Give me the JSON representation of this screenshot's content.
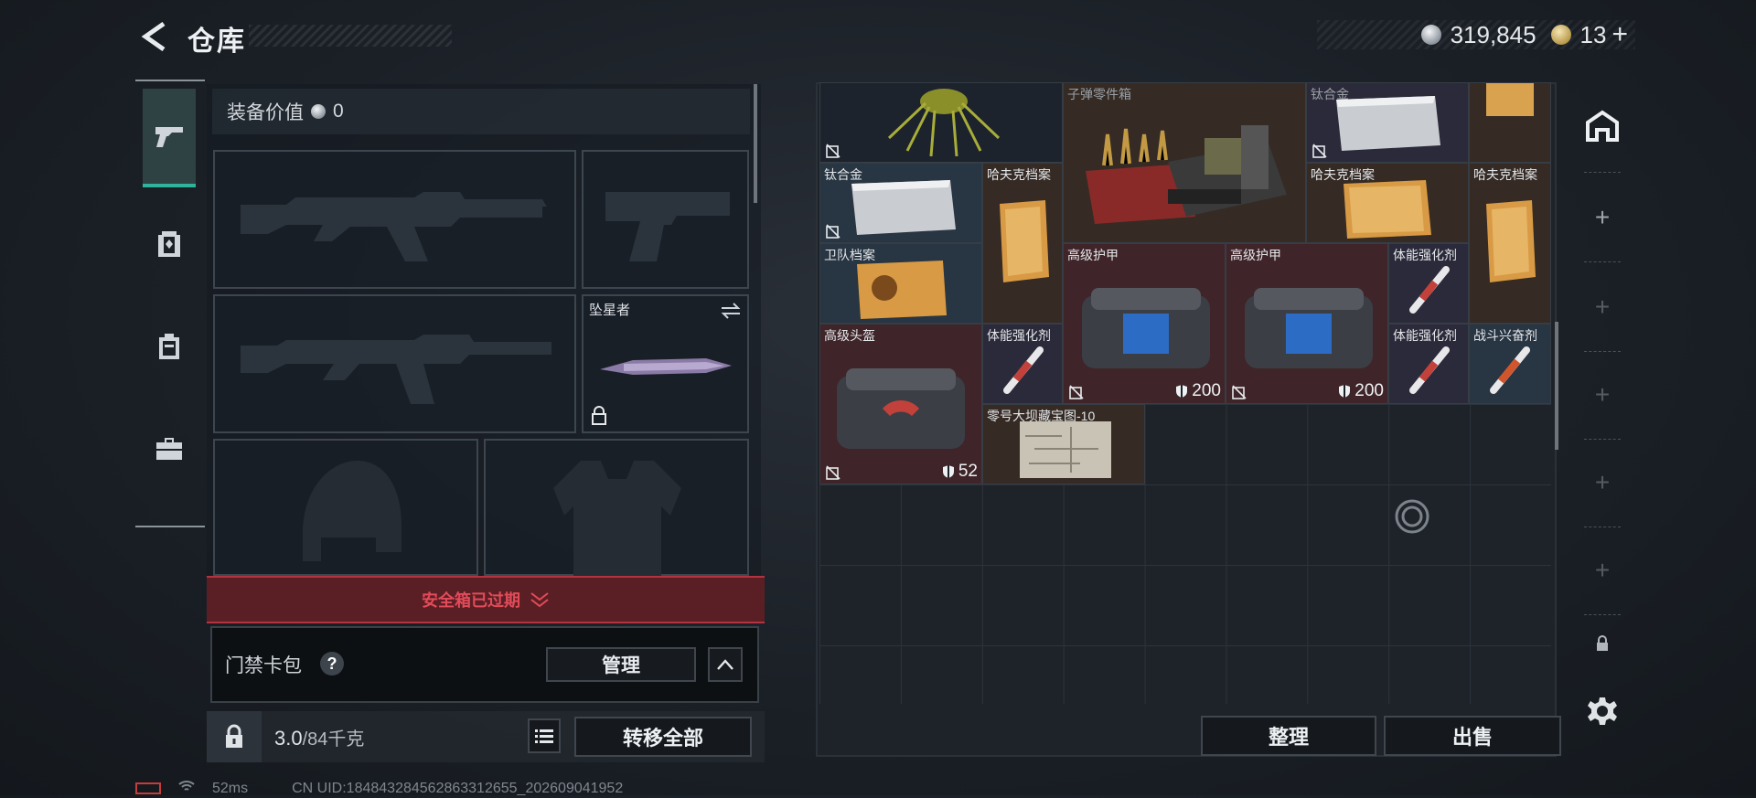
{
  "header": {
    "title": "仓库",
    "currency_silver": "319,845",
    "currency_gold": "13",
    "currency_add": "+"
  },
  "loadout": {
    "equip_value_label": "装备价值",
    "equip_value": "0",
    "melee_slot_label": "坠星者"
  },
  "safe_box": {
    "expired_text": "安全箱已过期"
  },
  "card_pack": {
    "label": "门禁卡包",
    "help": "?",
    "manage_label": "管理"
  },
  "bottom_left": {
    "weight_current": "3.0",
    "weight_max": "/84千克",
    "transfer_all_label": "转移全部"
  },
  "status_bar": {
    "ping": "52ms",
    "uid": "CN UID:18484328456286331265​5_202609041952"
  },
  "inventory": {
    "items": [
      {
        "label": ""
      },
      {
        "label": "子弹零件箱"
      },
      {
        "label": "钛合金"
      },
      {
        "label": ""
      },
      {
        "label": "钛合金"
      },
      {
        "label": "哈夫克档案"
      },
      {
        "label": "哈夫克档案"
      },
      {
        "label": "哈夫克档案"
      },
      {
        "label": "卫队档案"
      },
      {
        "label": "高级护甲",
        "armor": "200"
      },
      {
        "label": "高级护甲",
        "armor": "200"
      },
      {
        "label": "体能强化剂"
      },
      {
        "label": "高级头盔",
        "armor": "52"
      },
      {
        "label": "体能强化剂"
      },
      {
        "label": "体能强化剂"
      },
      {
        "label": "战斗兴奋剂"
      },
      {
        "label": "零号大坝藏宝图-10"
      }
    ],
    "sort_label": "整理",
    "sell_label": "出售"
  },
  "tools": {
    "add_labels": [
      "+",
      "+",
      "+",
      "+",
      "+"
    ]
  },
  "colors": {
    "accent_teal": "#2fb39b",
    "warning_red": "#e24b5a",
    "background": "#1b2027"
  }
}
